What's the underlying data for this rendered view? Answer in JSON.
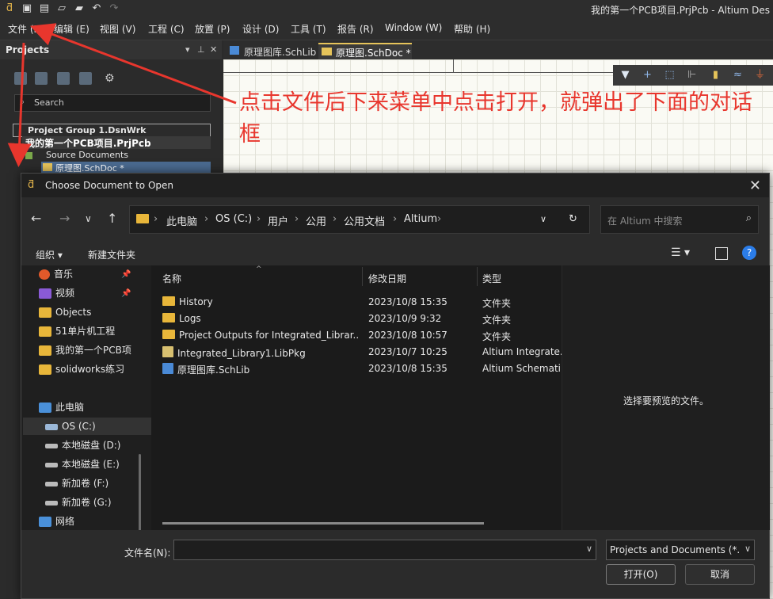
{
  "window": {
    "title": "我的第一个PCB项目.PrjPcb - Altium Des"
  },
  "menu": [
    "文件 (F)",
    "编辑 (E)",
    "视图 (V)",
    "工程 (C)",
    "放置 (P)",
    "设计 (D)",
    "工具 (T)",
    "报告 (R)",
    "Window (W)",
    "帮助 (H)"
  ],
  "projects_panel": {
    "title": "Projects",
    "search_label": "Search",
    "tree": {
      "group": "Project Group 1.DsnWrk",
      "project": "我的第一个PCB项目.PrjPcb",
      "folder": "Source Documents",
      "doc": "原理图.SchDoc *"
    }
  },
  "doc_tabs": [
    "原理图库.SchLib",
    "原理图.SchDoc *"
  ],
  "annotation": {
    "text": "点击文件后下来菜单中点击打开，就弹出了下面的对话框",
    "color": "#e8362d"
  },
  "dialog": {
    "title": "Choose Document to Open",
    "breadcrumb": [
      "此电脑",
      "OS (C:)",
      "用户",
      "公用",
      "公用文档",
      "Altium"
    ],
    "search_placeholder": "在 Altium 中搜索",
    "commands": {
      "organize": "组织",
      "new_folder": "新建文件夹"
    },
    "nav_items": [
      {
        "label": "音乐",
        "color": "#e0592a",
        "pinned": true
      },
      {
        "label": "视频",
        "color": "#8a5ad6",
        "pinned": true
      },
      {
        "label": "Objects",
        "color": "#e8b63a",
        "pinned": false
      },
      {
        "label": "51单片机工程",
        "color": "#e8b63a",
        "pinned": false
      },
      {
        "label": "我的第一个PCB项",
        "color": "#e8b63a",
        "pinned": false
      },
      {
        "label": "solidworks练习",
        "color": "#e8b63a",
        "pinned": false
      },
      {
        "label": "此电脑",
        "color": "#4a90d9",
        "pinned": false
      },
      {
        "label": "OS (C:)",
        "color": "#9bb8d8",
        "pinned": false
      },
      {
        "label": "本地磁盘 (D:)",
        "color": "#bbbbbb",
        "pinned": false
      },
      {
        "label": "本地磁盘 (E:)",
        "color": "#bbbbbb",
        "pinned": false
      },
      {
        "label": "新加卷 (F:)",
        "color": "#bbbbbb",
        "pinned": false
      },
      {
        "label": "新加卷 (G:)",
        "color": "#bbbbbb",
        "pinned": false
      },
      {
        "label": "网络",
        "color": "#4a90d9",
        "pinned": false
      }
    ],
    "columns": {
      "name": "名称",
      "date": "修改日期",
      "type": "类型"
    },
    "files": [
      {
        "name": "History",
        "date": "2023/10/8 15:35",
        "type": "文件夹",
        "icon": "folder-icon"
      },
      {
        "name": "Logs",
        "date": "2023/10/9 9:32",
        "type": "文件夹",
        "icon": "folder-icon"
      },
      {
        "name": "Project Outputs for Integrated_Librar...",
        "date": "2023/10/8 10:57",
        "type": "文件夹",
        "icon": "folder-icon"
      },
      {
        "name": "Integrated_Library1.LibPkg",
        "date": "2023/10/7 10:25",
        "type": "Altium Integrate...",
        "icon": "libpkg-icon"
      },
      {
        "name": "原理图库.SchLib",
        "date": "2023/10/8 15:35",
        "type": "Altium Schemati...",
        "icon": "schlib-icon"
      }
    ],
    "preview_text": "选择要预览的文件。",
    "filename_label": "文件名(N):",
    "filename_value": "",
    "filter_value": "Projects and Documents (*.D",
    "open_button": "打开(O)",
    "cancel_button": "取消"
  }
}
